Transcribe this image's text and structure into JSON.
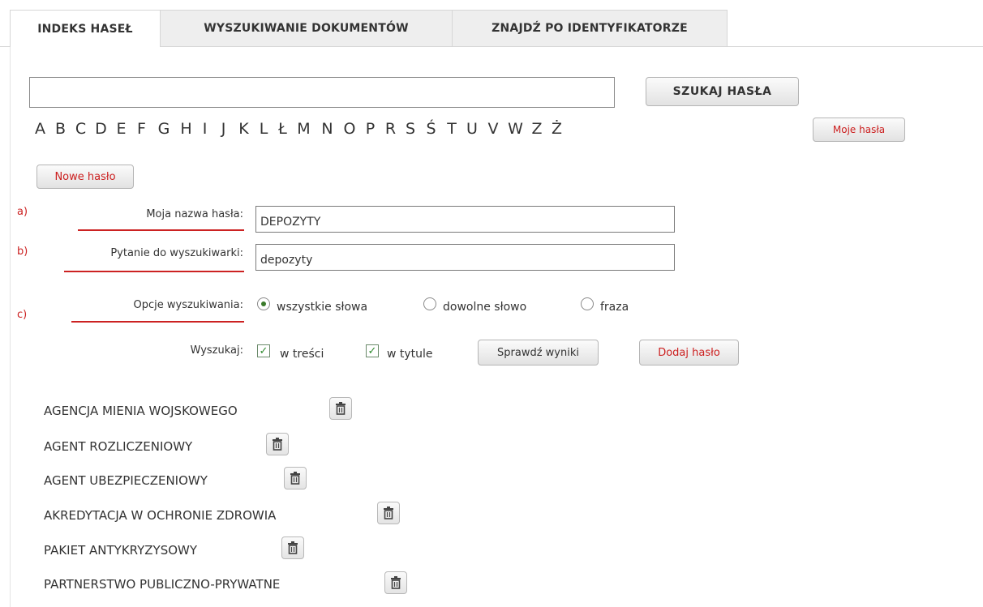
{
  "tabs": [
    {
      "label": "INDEKS HASEŁ",
      "active": true
    },
    {
      "label": "WYSZUKIWANIE DOKUMENTÓW",
      "active": false
    },
    {
      "label": "ZNAJDŹ PO IDENTYFIKATORZE",
      "active": false
    }
  ],
  "search": {
    "value": "",
    "button_label": "SZUKAJ HASŁA"
  },
  "alphabet": [
    "A",
    "B",
    "C",
    "D",
    "E",
    "F",
    "G",
    "H",
    "I",
    "J",
    "K",
    "L",
    "Ł",
    "M",
    "N",
    "O",
    "P",
    "R",
    "S",
    "Ś",
    "T",
    "U",
    "V",
    "W",
    "Z",
    "Ż"
  ],
  "my_entries_label": "Moje hasła",
  "new_entry_label": "Nowe hasło",
  "form": {
    "markers": [
      "a)",
      "b)",
      "c)"
    ],
    "name_label": "Moja nazwa hasła:",
    "name_value": "DEPOZYTY",
    "query_label": "Pytanie do wyszukiwarki:",
    "query_value": "depozyty",
    "options_label": "Opcje wyszukiwania:",
    "options": [
      {
        "label": "wszystkie słowa",
        "selected": true
      },
      {
        "label": "dowolne słowo",
        "selected": false
      },
      {
        "label": "fraza",
        "selected": false
      }
    ],
    "search_in_label": "Wyszukaj:",
    "search_in": [
      {
        "label": "w treści",
        "checked": true
      },
      {
        "label": "w tytule",
        "checked": true
      }
    ],
    "check_results_label": "Sprawdź wyniki",
    "add_entry_label": "Dodaj hasło"
  },
  "entries": [
    "AGENCJA MIENIA WOJSKOWEGO",
    "AGENT ROZLICZENIOWY",
    "AGENT UBEZPIECZENIOWY",
    "AKREDYTACJA W OCHRONIE ZDROWIA",
    "PAKIET ANTYKRYZYSOWY",
    "PARTNERSTWO PUBLICZNO-PRYWATNE"
  ],
  "icons": {
    "delete": "trash-icon"
  },
  "colors": {
    "accent_red": "#cc2222",
    "check_green": "#2e8b2e"
  }
}
